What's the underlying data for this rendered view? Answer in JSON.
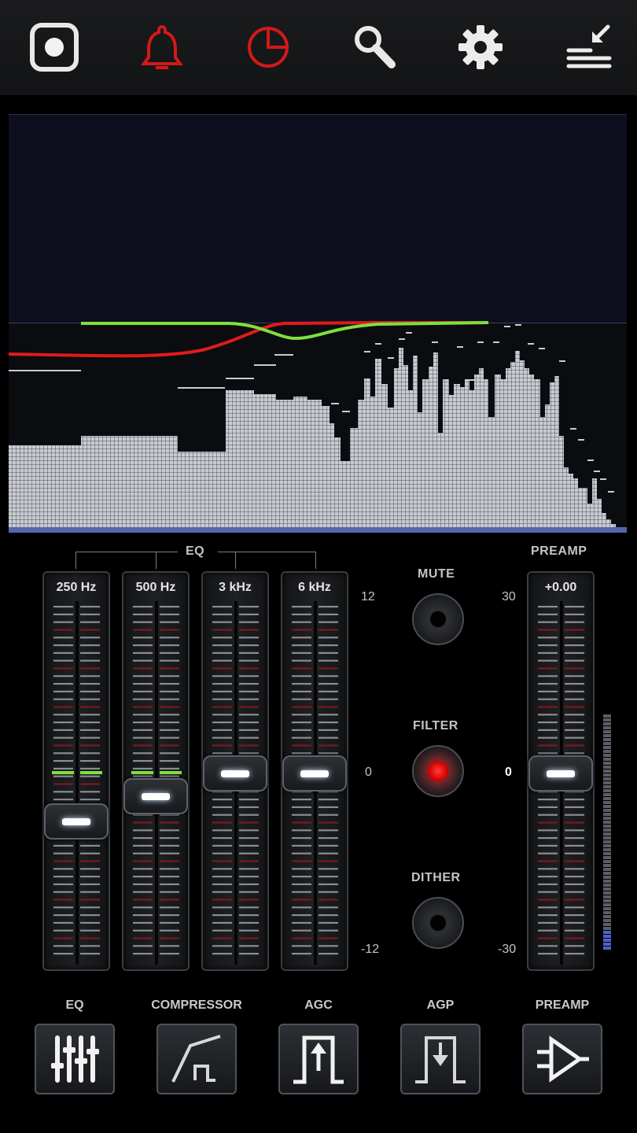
{
  "toolbar": {
    "icons": [
      "record-icon",
      "bell-icon",
      "timer-icon",
      "search-icon",
      "gear-icon",
      "collapse-icon"
    ],
    "accent_red": "#d31919"
  },
  "eq": {
    "label": "EQ",
    "bands": [
      {
        "label": "250 Hz",
        "gain_db": -2.5
      },
      {
        "label": "500 Hz",
        "gain_db": -1.2
      },
      {
        "label": "3 kHz",
        "gain_db": 0
      },
      {
        "label": "6 kHz",
        "gain_db": 0
      }
    ],
    "scale": {
      "max": "12",
      "mid": "0",
      "min": "-12"
    }
  },
  "toggles": {
    "mute": {
      "label": "MUTE",
      "on": false
    },
    "filter": {
      "label": "FILTER",
      "on": true
    },
    "dither": {
      "label": "DITHER",
      "on": false
    }
  },
  "preamp": {
    "label": "PREAMP",
    "value": "+0.00",
    "scale": {
      "max": "30",
      "mid": "0",
      "min": "-30"
    }
  },
  "modules": [
    {
      "label": "EQ",
      "icon": "sliders-icon"
    },
    {
      "label": "COMPRESSOR",
      "icon": "compressor-curve-icon"
    },
    {
      "label": "AGC",
      "icon": "agc-icon"
    },
    {
      "label": "AGP",
      "icon": "agp-icon"
    },
    {
      "label": "PREAMP",
      "icon": "amplifier-icon"
    }
  ],
  "colors": {
    "eq_curve": "#7fe03d",
    "filter_curve": "#e11b1b",
    "spectrum_bars": "#c9cbd2",
    "led_red": "#ff2020"
  }
}
